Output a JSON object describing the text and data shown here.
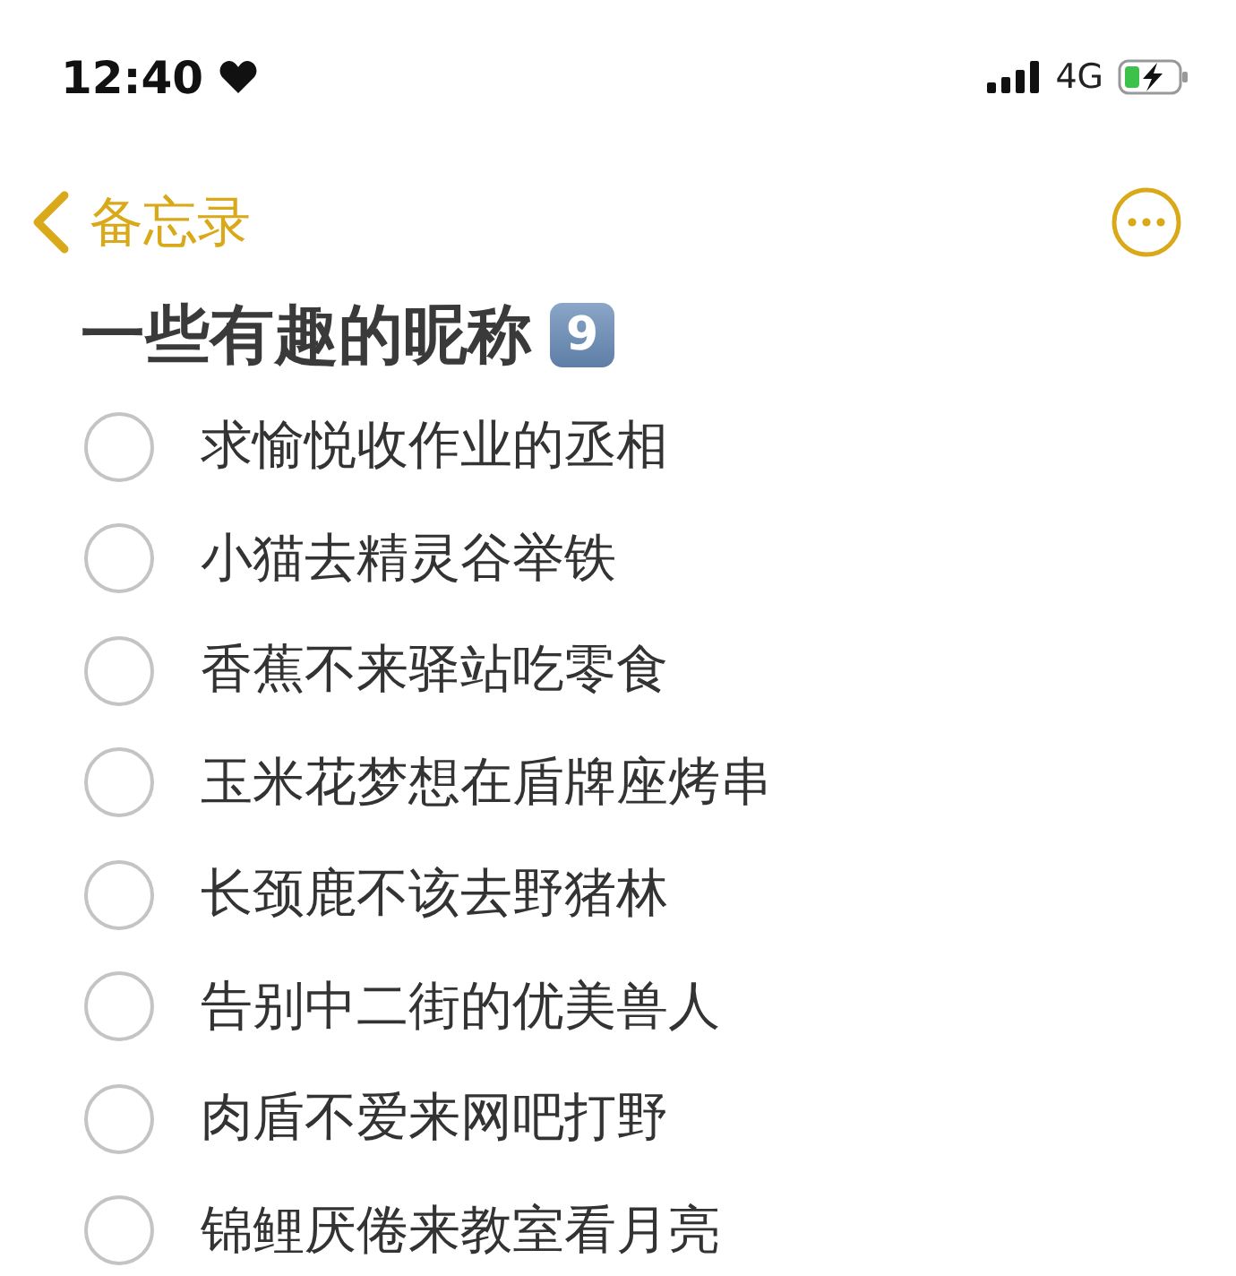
{
  "status_bar": {
    "time": "12:40",
    "network": "4G"
  },
  "nav": {
    "back_label": "备忘录"
  },
  "note": {
    "title": "一些有趣的昵称",
    "title_badge": "9",
    "items": [
      {
        "text": "求愉悦收作业的丞相",
        "checked": false
      },
      {
        "text": "小猫去精灵谷举铁",
        "checked": false
      },
      {
        "text": "香蕉不来驿站吃零食",
        "checked": false
      },
      {
        "text": "玉米花梦想在盾牌座烤串",
        "checked": false
      },
      {
        "text": "长颈鹿不该去野猪林",
        "checked": false
      },
      {
        "text": "告别中二街的优美兽人",
        "checked": false
      },
      {
        "text": "肉盾不爱来网吧打野",
        "checked": false
      },
      {
        "text": "锦鲤厌倦来教室看月亮",
        "checked": false
      }
    ]
  }
}
